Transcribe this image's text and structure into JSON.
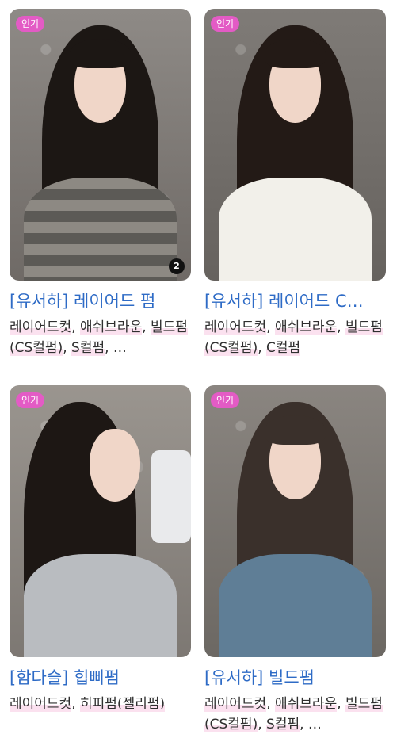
{
  "cards": [
    {
      "badge": "인기",
      "photo_count": "2",
      "title": "[유서하] 레이어드 펌",
      "tags": [
        "레이어드컷",
        "애쉬브라운",
        "빌드펌(CS컬펌)",
        "S컬펌",
        "…"
      ],
      "hair_color": "#1c1714",
      "top_color": "#7a7772"
    },
    {
      "badge": "인기",
      "title": "[유서하] 레이어드 C…",
      "tags": [
        "레이어드컷",
        "애쉬브라운",
        "빌드펌(CS컬펌)",
        "C컬펌"
      ],
      "hair_color": "#231a16",
      "top_color": "#f2f0ea"
    },
    {
      "badge": "인기",
      "title": "[함다슬] 힙삐펌",
      "tags": [
        "레이어드컷",
        "히피펌(젤리펌)"
      ],
      "hair_color": "#1d1714",
      "top_color": "#b9bcc0"
    },
    {
      "badge": "인기",
      "title": "[유서하] 빌드펌",
      "tags": [
        "레이어드컷",
        "애쉬브라운",
        "빌드펌(CS컬펌)",
        "S컬펌",
        "…"
      ],
      "hair_color": "#3a302b",
      "top_color": "#5f7e96"
    }
  ]
}
